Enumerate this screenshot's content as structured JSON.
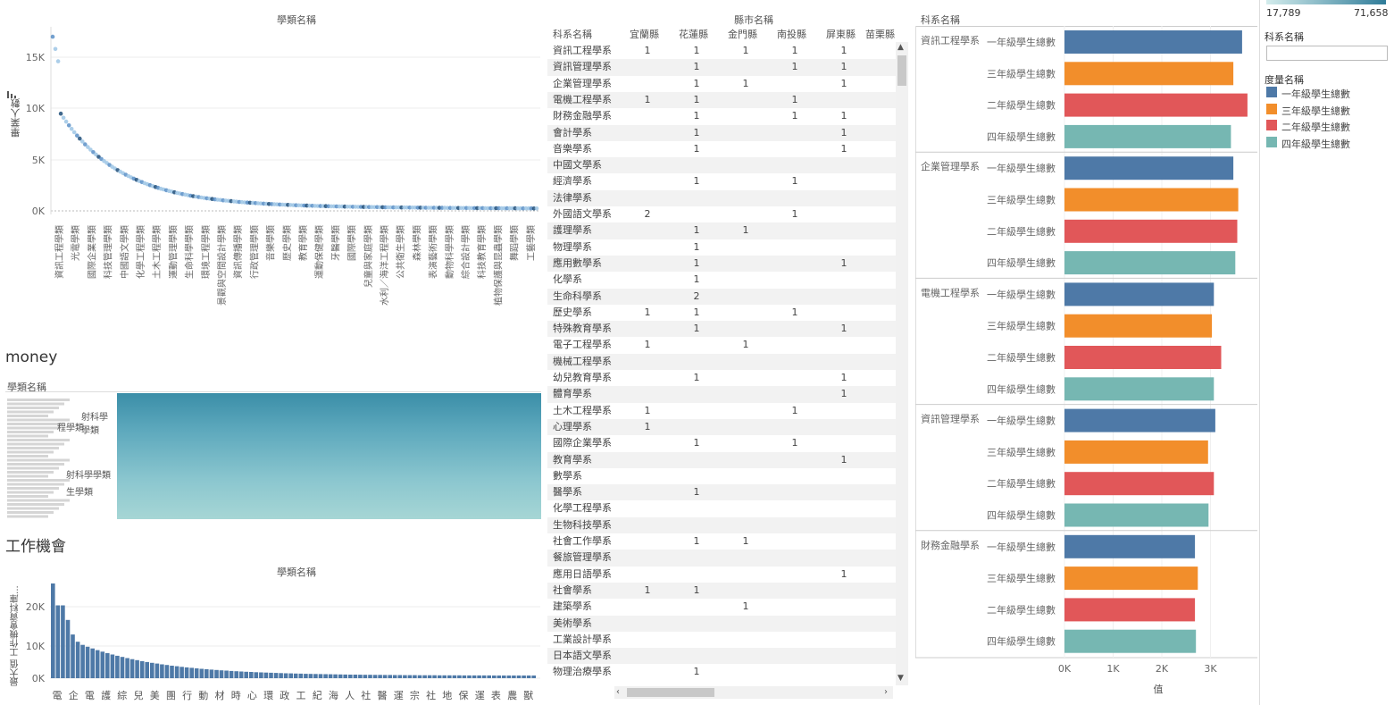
{
  "scatter": {
    "title": "學類名稱",
    "ylabel": "畢業人數",
    "yticks": [
      "15K",
      "10K",
      "5K",
      "0K"
    ],
    "xlabels": [
      "資訊工程學類",
      "光電學類",
      "國際企業學類",
      "科技管理學類",
      "中國語文學類",
      "化學工程學類",
      "土木工程學類",
      "運動管理學類",
      "生命科學學類",
      "環境工程學類",
      "景觀與空間設計學類",
      "資訊傳播學類",
      "行政管理學類",
      "音樂學類",
      "歷史學類",
      "教育學類",
      "運動保健學類",
      "牙醫學類",
      "國際學類",
      "兒童與家庭學類",
      "水利／海洋工程學類",
      "公共衛生學類",
      "森林學類",
      "表演藝術學類",
      "動物科學學類",
      "綜合設計學類",
      "科技教育學類",
      "植物保護與昆蟲學類",
      "舞蹈學類",
      "工藝學類"
    ]
  },
  "money": {
    "title": "money",
    "label": "學類名稱",
    "overlap_text": [
      "射科學學類",
      "程學類",
      "生學類"
    ]
  },
  "jobs": {
    "title": "工作機會",
    "subtitle": "學類名稱",
    "ylabel": "最大值 工作機會資料庫...",
    "yticks": [
      "20K",
      "10K",
      "0K"
    ],
    "xchars": [
      "電",
      "企",
      "電",
      "護",
      "綜",
      "兒",
      "美",
      "團",
      "行",
      "動",
      "材",
      "時",
      "心",
      "環",
      "政",
      "工",
      "紀",
      "海",
      "人",
      "社",
      "醫",
      "運",
      "宗",
      "社",
      "地",
      "保",
      "運",
      "表",
      "農",
      "獸"
    ]
  },
  "crosstab": {
    "title": "縣市名稱",
    "row_header": "科系名稱",
    "columns": [
      "宜蘭縣",
      "花蓮縣",
      "金門縣",
      "南投縣",
      "屏東縣",
      "苗栗縣"
    ],
    "rows": [
      {
        "name": "資訊工程學系",
        "v": [
          "1",
          "1",
          "1",
          "1",
          "1",
          ""
        ]
      },
      {
        "name": "資訊管理學系",
        "v": [
          "",
          "1",
          "",
          "1",
          "1",
          ""
        ]
      },
      {
        "name": "企業管理學系",
        "v": [
          "",
          "1",
          "1",
          "",
          "1",
          ""
        ]
      },
      {
        "name": "電機工程學系",
        "v": [
          "1",
          "1",
          "",
          "1",
          "",
          ""
        ]
      },
      {
        "name": "財務金融學系",
        "v": [
          "",
          "1",
          "",
          "1",
          "1",
          ""
        ]
      },
      {
        "name": "會計學系",
        "v": [
          "",
          "1",
          "",
          "",
          "1",
          ""
        ]
      },
      {
        "name": "音樂學系",
        "v": [
          "",
          "1",
          "",
          "",
          "1",
          ""
        ]
      },
      {
        "name": "中國文學系",
        "v": [
          "",
          "",
          "",
          "",
          "",
          ""
        ]
      },
      {
        "name": "經濟學系",
        "v": [
          "",
          "1",
          "",
          "1",
          "",
          ""
        ]
      },
      {
        "name": "法律學系",
        "v": [
          "",
          "",
          "",
          "",
          "",
          ""
        ]
      },
      {
        "name": "外國語文學系",
        "v": [
          "2",
          "",
          "",
          "1",
          "",
          ""
        ]
      },
      {
        "name": "護理學系",
        "v": [
          "",
          "1",
          "1",
          "",
          "",
          ""
        ]
      },
      {
        "name": "物理學系",
        "v": [
          "",
          "1",
          "",
          "",
          "",
          ""
        ]
      },
      {
        "name": "應用數學系",
        "v": [
          "",
          "1",
          "",
          "",
          "1",
          ""
        ]
      },
      {
        "name": "化學系",
        "v": [
          "",
          "1",
          "",
          "",
          "",
          ""
        ]
      },
      {
        "name": "生命科學系",
        "v": [
          "",
          "2",
          "",
          "",
          "",
          ""
        ]
      },
      {
        "name": "歷史學系",
        "v": [
          "1",
          "1",
          "",
          "1",
          "",
          ""
        ]
      },
      {
        "name": "特殊教育學系",
        "v": [
          "",
          "1",
          "",
          "",
          "1",
          ""
        ]
      },
      {
        "name": "電子工程學系",
        "v": [
          "1",
          "",
          "1",
          "",
          "",
          ""
        ]
      },
      {
        "name": "機械工程學系",
        "v": [
          "",
          "",
          "",
          "",
          "",
          ""
        ]
      },
      {
        "name": "幼兒教育學系",
        "v": [
          "",
          "1",
          "",
          "",
          "1",
          ""
        ]
      },
      {
        "name": "體育學系",
        "v": [
          "",
          "",
          "",
          "",
          "1",
          ""
        ]
      },
      {
        "name": "土木工程學系",
        "v": [
          "1",
          "",
          "",
          "1",
          "",
          ""
        ]
      },
      {
        "name": "心理學系",
        "v": [
          "1",
          "",
          "",
          "",
          "",
          ""
        ]
      },
      {
        "name": "國際企業學系",
        "v": [
          "",
          "1",
          "",
          "1",
          "",
          ""
        ]
      },
      {
        "name": "教育學系",
        "v": [
          "",
          "",
          "",
          "",
          "1",
          ""
        ]
      },
      {
        "name": "數學系",
        "v": [
          "",
          "",
          "",
          "",
          "",
          ""
        ]
      },
      {
        "name": "醫學系",
        "v": [
          "",
          "1",
          "",
          "",
          "",
          ""
        ]
      },
      {
        "name": "化學工程學系",
        "v": [
          "",
          "",
          "",
          "",
          "",
          ""
        ]
      },
      {
        "name": "生物科技學系",
        "v": [
          "",
          "",
          "",
          "",
          "",
          ""
        ]
      },
      {
        "name": "社會工作學系",
        "v": [
          "",
          "1",
          "1",
          "",
          "",
          ""
        ]
      },
      {
        "name": "餐旅管理學系",
        "v": [
          "",
          "",
          "",
          "",
          "",
          ""
        ]
      },
      {
        "name": "應用日語學系",
        "v": [
          "",
          "",
          "",
          "",
          "1",
          ""
        ]
      },
      {
        "name": "社會學系",
        "v": [
          "1",
          "1",
          "",
          "",
          "",
          ""
        ]
      },
      {
        "name": "建築學系",
        "v": [
          "",
          "",
          "1",
          "",
          "",
          ""
        ]
      },
      {
        "name": "美術學系",
        "v": [
          "",
          "",
          "",
          "",
          "",
          ""
        ]
      },
      {
        "name": "工業設計學系",
        "v": [
          "",
          "",
          "",
          "",
          "",
          ""
        ]
      },
      {
        "name": "日本語文學系",
        "v": [
          "",
          "",
          "",
          "",
          "",
          ""
        ]
      },
      {
        "name": "物理治療學系",
        "v": [
          "",
          "1",
          "",
          "",
          "",
          ""
        ]
      }
    ]
  },
  "bars": {
    "header": "科系名稱",
    "xlabel": "值",
    "xticks": [
      "0K",
      "1K",
      "2K",
      "3K"
    ],
    "measures": [
      "一年級學生總數",
      "三年級學生總數",
      "二年級學生總數",
      "四年級學生總數"
    ],
    "colors": [
      "#4e79a7",
      "#f28e2b",
      "#e15759",
      "#76b7b2"
    ],
    "groups": [
      {
        "name": "資訊工程學系",
        "values": [
          3650,
          3470,
          3760,
          3420
        ]
      },
      {
        "name": "企業管理學系",
        "values": [
          3470,
          3570,
          3550,
          3510
        ]
      },
      {
        "name": "電機工程學系",
        "values": [
          3070,
          3030,
          3220,
          3070
        ]
      },
      {
        "name": "資訊管理學系",
        "values": [
          3100,
          2950,
          3070,
          2960
        ]
      },
      {
        "name": "財務金融學系",
        "values": [
          2680,
          2740,
          2680,
          2700
        ]
      }
    ]
  },
  "legend": {
    "range_min": "17,789",
    "range_max": "71,658",
    "filter_label": "科系名稱",
    "filter_value": "",
    "measure_title": "度量名稱",
    "items": [
      "一年級學生總數",
      "三年級學生總數",
      "二年級學生總數",
      "四年級學生總數"
    ],
    "colors": [
      "#4e79a7",
      "#f28e2b",
      "#e15759",
      "#76b7b2"
    ]
  }
}
